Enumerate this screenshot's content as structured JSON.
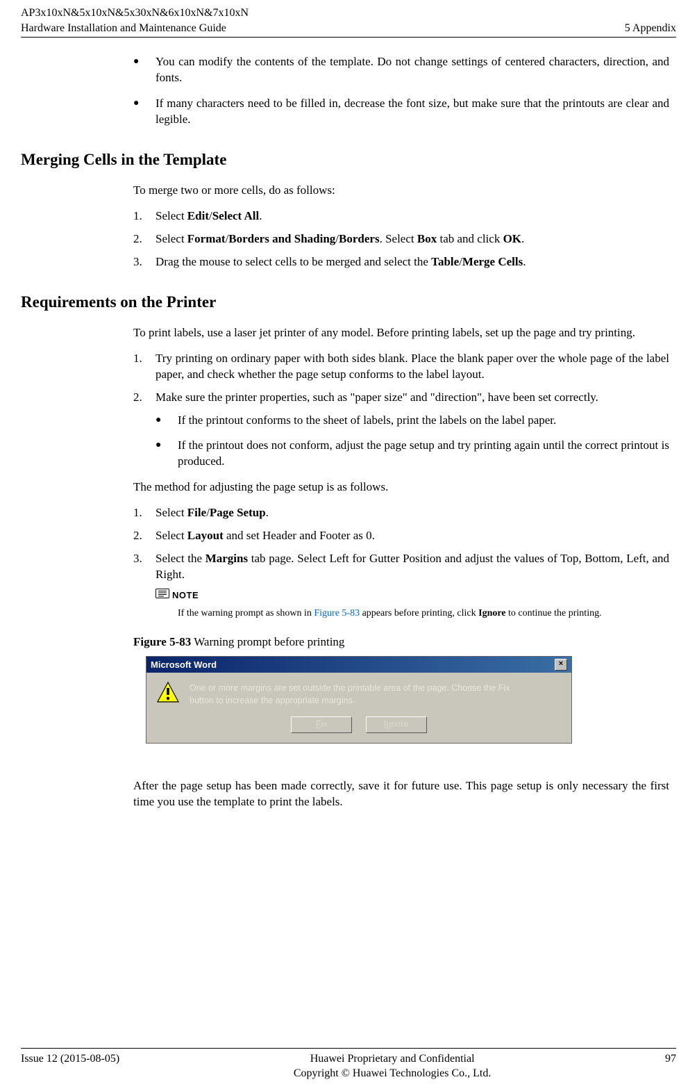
{
  "header": {
    "product_line1": "AP3x10xN&5x10xN&5x30xN&6x10xN&7x10xN",
    "product_line2": "Hardware Installation and Maintenance Guide",
    "section": "5 Appendix"
  },
  "intro_bullets": [
    "You can modify the contents of the template. Do not change settings of centered characters, direction, and fonts.",
    "If many characters need to be filled in, decrease the font size, but make sure that the printouts are clear and legible."
  ],
  "merging": {
    "heading": "Merging Cells in the Template",
    "lead": "To merge two or more cells, do as follows:",
    "steps": {
      "s1": {
        "pre": "Select ",
        "b1": "Edit",
        "sep1": "/",
        "b2": "Select All",
        "post": "."
      },
      "s2": {
        "pre": "Select ",
        "b1": "Format",
        "sep1": "/",
        "b2": "Borders and Shading",
        "sep2": "/",
        "b3": "Borders",
        "mid": ". Select ",
        "b4": "Box",
        "mid2": " tab and click ",
        "b5": "OK",
        "post": "."
      },
      "s3": {
        "pre": "Drag the mouse to select cells to be merged and select the ",
        "b1": "Table",
        "sep1": "/",
        "b2": "Merge Cells",
        "post": "."
      }
    }
  },
  "printer": {
    "heading": "Requirements on the Printer",
    "lead": "To print labels, use a laser jet printer of any model. Before printing labels, set up the page and try printing.",
    "steps_a": [
      "Try printing on ordinary paper with both sides blank. Place the blank paper over the whole page of the label paper, and check whether the page setup conforms to the label layout.",
      "Make sure the printer properties, such as \"paper size\" and \"direction\", have been set correctly."
    ],
    "sub_bullets": [
      "If the printout conforms to the sheet of labels, print the labels on the label paper.",
      "If the printout does not conform, adjust the page setup and try printing again until the correct printout is produced."
    ],
    "method_lead": "The method for adjusting the page setup is as follows.",
    "steps_b": {
      "s1": {
        "pre": "Select ",
        "b1": "File",
        "sep1": "/",
        "b2": "Page Setup",
        "post": "."
      },
      "s2": {
        "pre": "Select ",
        "b1": "Layout",
        "post": " and set Header and Footer as 0."
      },
      "s3": {
        "pre": "Select the ",
        "b1": "Margins",
        "post": " tab page. Select Left for Gutter Position and adjust the values of Top, Bottom, Left, and Right."
      }
    },
    "note": {
      "label": "NOTE",
      "text_pre": "If the warning prompt as shown in ",
      "link": "Figure 5-83",
      "text_mid": " appears before printing, click ",
      "bold": "Ignore",
      "text_post": " to continue the printing."
    },
    "figure": {
      "label": "Figure 5-83",
      "caption": " Warning prompt before printing"
    },
    "dialog": {
      "title": "Microsoft Word",
      "message_l1": "One or more margins are set outside the printable area of the page.  Choose the Fix",
      "message_l2": "button to increase the appropriate margins.",
      "fix_u": "F",
      "fix_rest": "ix",
      "ignore_u": "I",
      "ignore_rest": "gnore"
    },
    "closing": "After the page setup has been made correctly, save it for future use. This page setup is only necessary the first time you use the template to print the labels."
  },
  "footer": {
    "issue": "Issue 12 (2015-08-05)",
    "confidential": "Huawei Proprietary and Confidential",
    "copyright": "Copyright © Huawei Technologies Co., Ltd.",
    "page": "97"
  }
}
